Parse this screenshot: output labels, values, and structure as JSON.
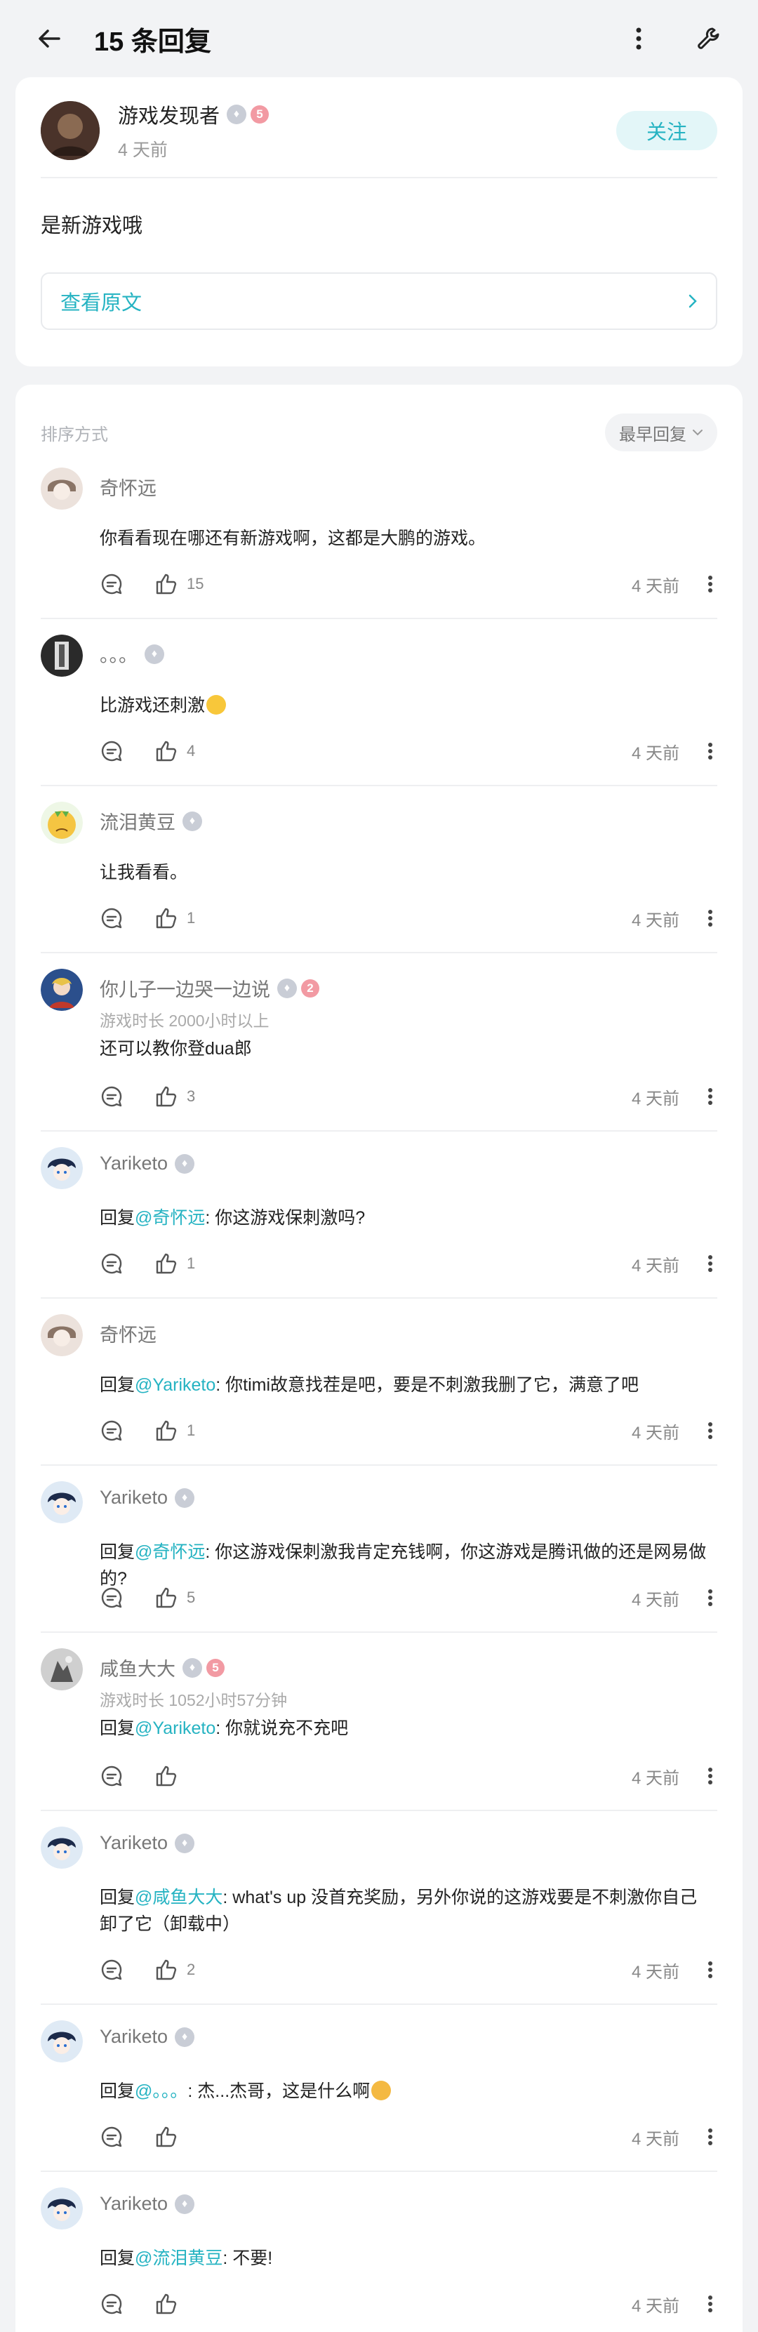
{
  "header": {
    "title": "15 条回复"
  },
  "post": {
    "author": "游戏发现者",
    "level": "5",
    "time": "4 天前",
    "follow_label": "关注",
    "text": "是新游戏哦",
    "view_original_label": "查看原文"
  },
  "sort": {
    "label": "排序方式",
    "current": "最早回复"
  },
  "colors": {
    "accent": "#25b3c2",
    "follow_bg": "#e3f6f8"
  },
  "comments": [
    {
      "name": "奇怀远",
      "sub": "",
      "text": "你看看现在哪还有新游戏啊，这都是大鹏的游戏。",
      "reply_prefix": "",
      "mention": "",
      "reply_text": "",
      "likes": "15",
      "time": "4 天前"
    },
    {
      "name": "。。。",
      "sub": "",
      "text": "比游戏还刺激",
      "likes": "4",
      "time": "4 天前"
    },
    {
      "name": "流泪黄豆",
      "sub": "",
      "text": "让我看看。",
      "likes": "1",
      "time": "4 天前"
    },
    {
      "name": "你儿子一边哭一边说",
      "level": "2",
      "sub": "游戏时长 2000小时以上",
      "text": "还可以教你登dua郎",
      "likes": "3",
      "time": "4 天前"
    },
    {
      "name": "Yariketo",
      "sub": "",
      "reply_prefix": "回复",
      "mention": "@奇怀远",
      "reply_text": ": 你这游戏保刺激吗?",
      "likes": "1",
      "time": "4 天前"
    },
    {
      "name": "奇怀远",
      "sub": "",
      "reply_prefix": "回复",
      "mention": "@Yariketo",
      "reply_text": ": 你timi故意找茬是吧，要是不刺激我删了它，满意了吧",
      "likes": "1",
      "time": "4 天前"
    },
    {
      "name": "Yariketo",
      "sub": "",
      "reply_prefix": "回复",
      "mention": "@奇怀远",
      "reply_text": ": 你这游戏保刺激我肯定充钱啊，你这游戏是腾讯做的还是网易做的?",
      "likes": "5",
      "time": "4 天前"
    },
    {
      "name": "咸鱼大大",
      "level": "5",
      "sub": "游戏时长 1052小时57分钟",
      "reply_prefix": "回复",
      "mention": "@Yariketo",
      "reply_text": ": 你就说充不充吧",
      "likes": "",
      "time": "4 天前"
    },
    {
      "name": "Yariketo",
      "sub": "",
      "reply_prefix": "回复",
      "mention": "@咸鱼大大",
      "reply_text": ": what's up 没首充奖励，另外你说的这游戏要是不刺激你自己卸了它（卸载中）",
      "likes": "2",
      "time": "4 天前"
    },
    {
      "name": "Yariketo",
      "sub": "",
      "reply_prefix": "回复",
      "mention": "@。。。",
      "reply_text": ": 杰...杰哥，这是什么啊",
      "likes": "",
      "time": "4 天前"
    },
    {
      "name": "Yariketo",
      "sub": "",
      "reply_prefix": "回复",
      "mention": "@流泪黄豆",
      "reply_text": ": 不要!",
      "likes": "",
      "time": "4 天前"
    }
  ]
}
